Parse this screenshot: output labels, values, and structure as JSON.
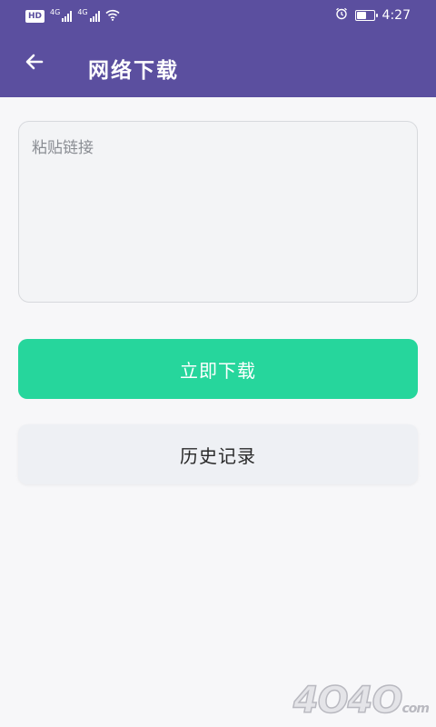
{
  "status_bar": {
    "hd_label": "HD",
    "sim1_network": "4G",
    "sim2_network": "4G",
    "time": "4:27",
    "icons": [
      "hd-icon",
      "signal-icon",
      "signal-icon",
      "wifi-icon",
      "alarm-icon",
      "battery-icon"
    ],
    "battery_level": 0.6
  },
  "app_bar": {
    "back_icon": "arrow-left-icon",
    "title": "网络下载"
  },
  "link_input": {
    "value": "",
    "placeholder": "粘贴链接"
  },
  "buttons": {
    "download_label": "立即下载",
    "history_label": "历史记录"
  },
  "watermark": {
    "text": "4O4O",
    "suffix": "com"
  },
  "colors": {
    "primary": "#5b4f9f",
    "accent": "#26d69c",
    "background": "#f7f7f9",
    "input_bg": "#f3f4f6",
    "secondary_button": "#eef0f4"
  }
}
